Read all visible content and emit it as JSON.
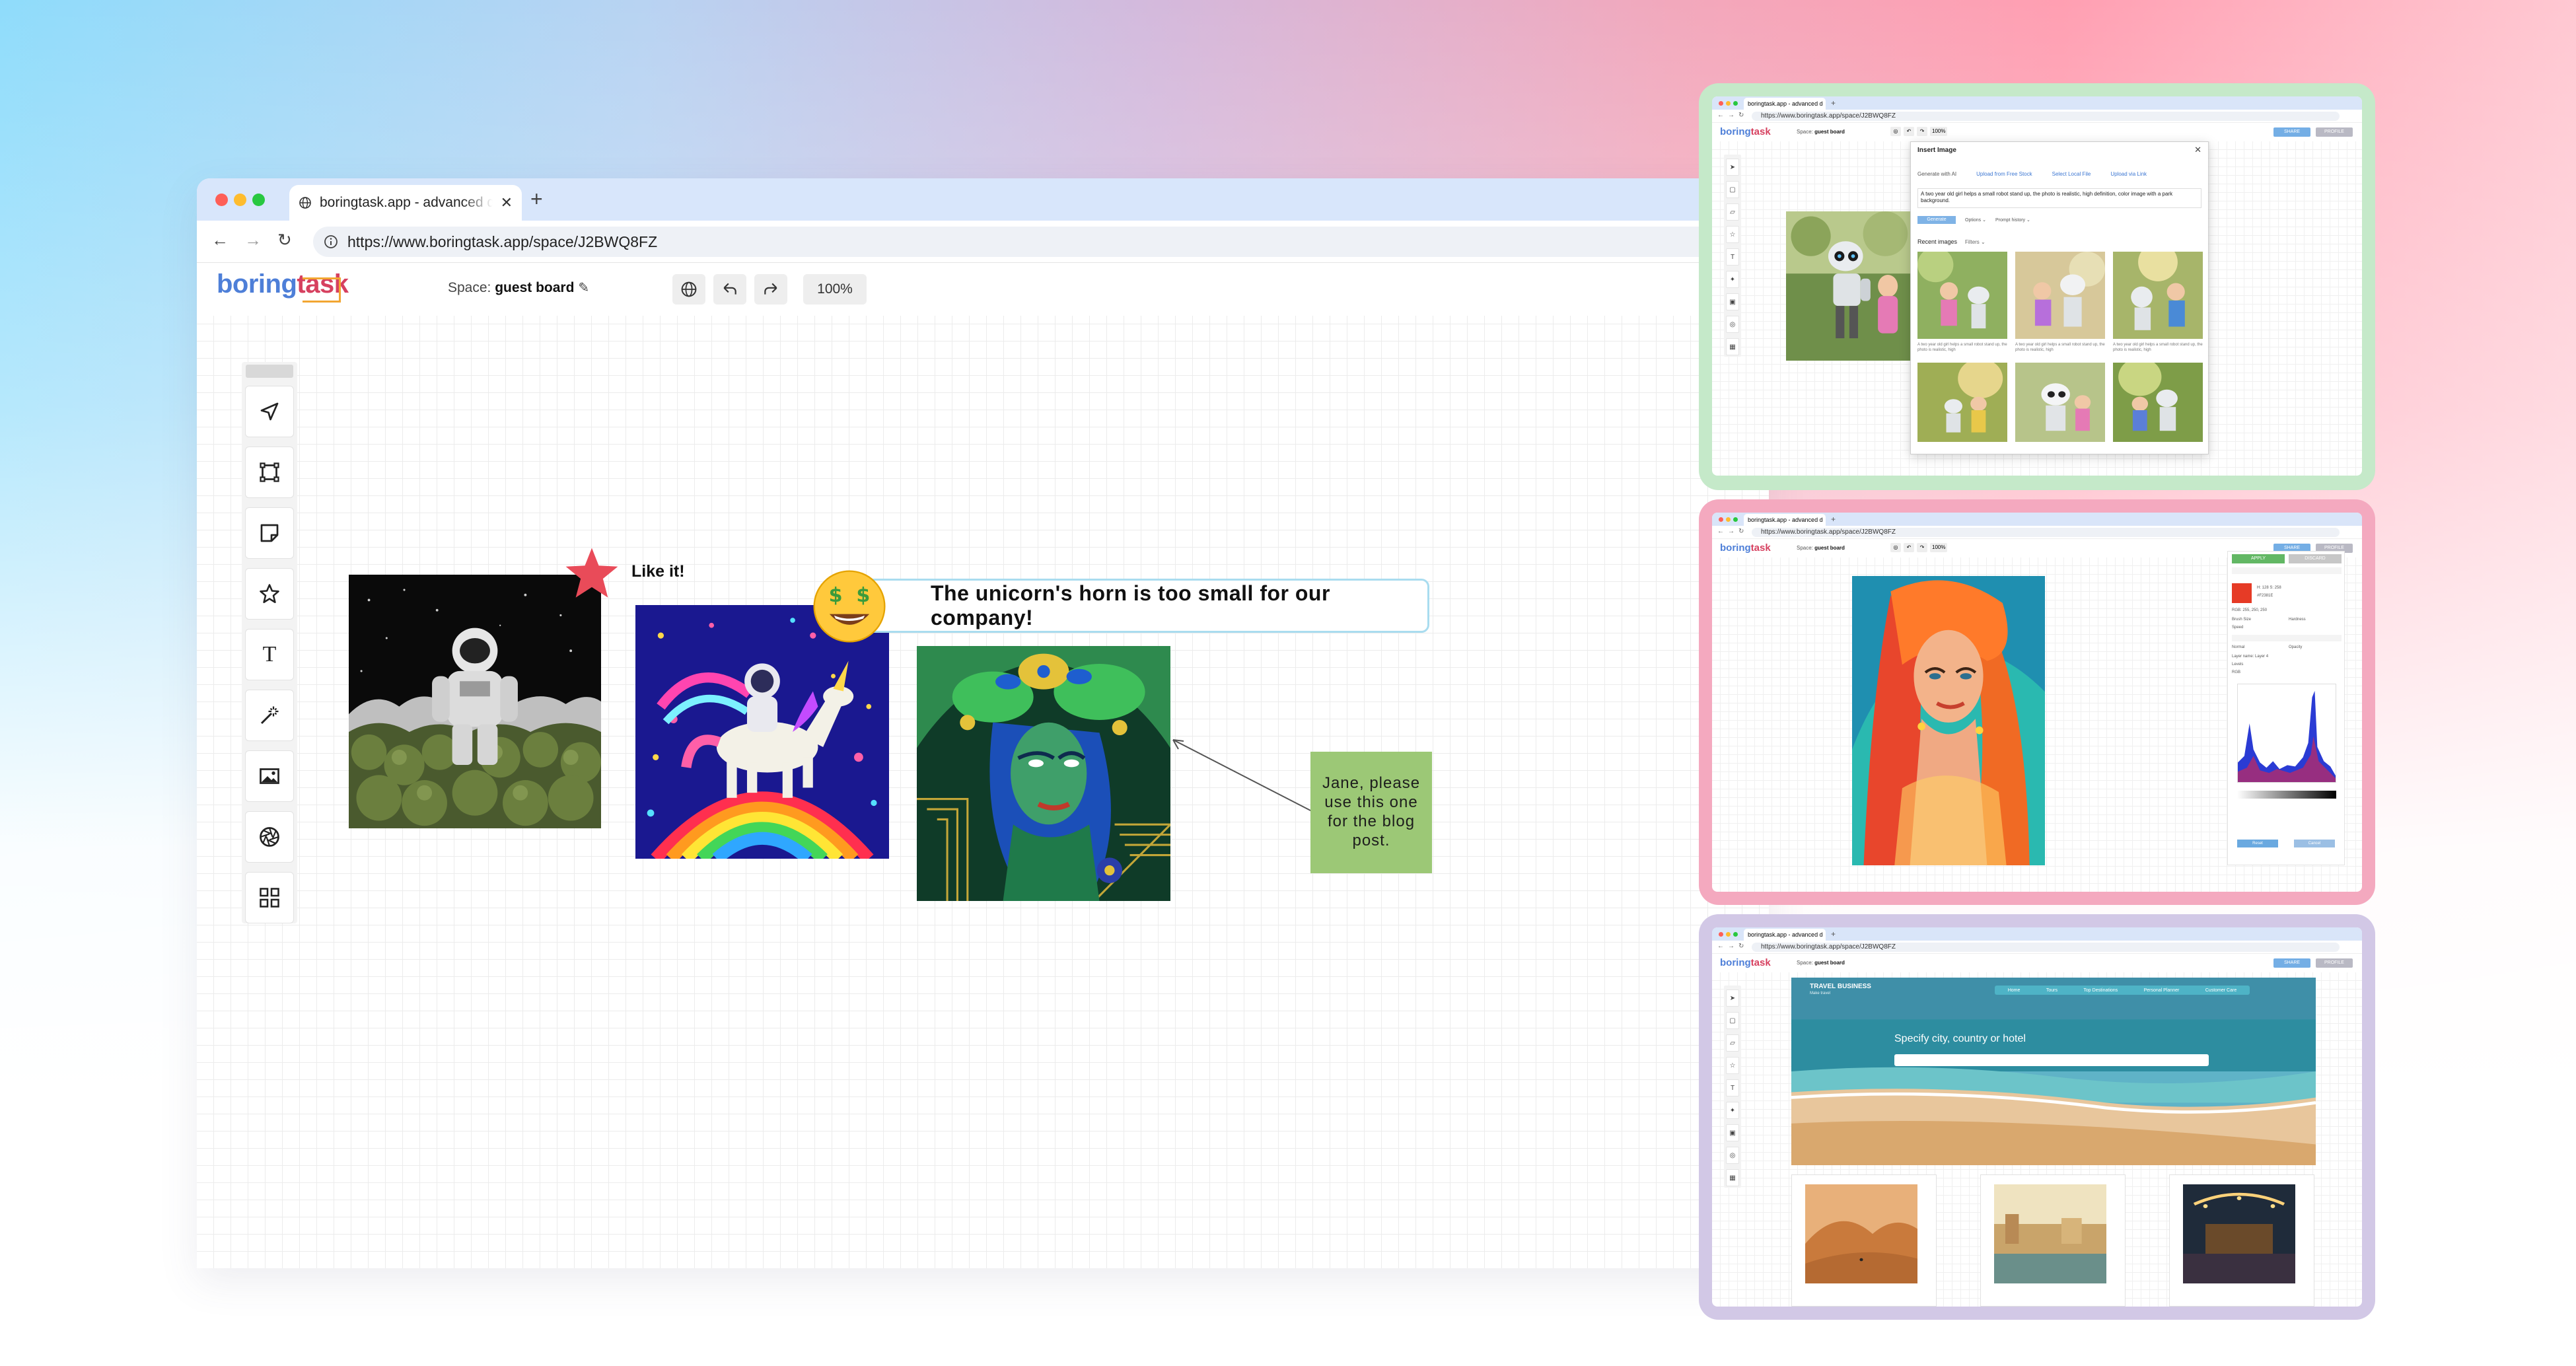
{
  "main_browser": {
    "tab_title": "boringtask.app - advanced d",
    "url": "https://www.boringtask.app/space/J2BWQ8FZ",
    "new_tab_label": "+",
    "tab_close_label": "✕"
  },
  "app_header": {
    "logo_boring": "boring",
    "logo_task": "task",
    "space_label": "Space:",
    "space_name": "guest board",
    "zoom": "100%"
  },
  "toolbar": {
    "tools": [
      "select-tool",
      "frame-tool",
      "sticky-note-tool",
      "shape-tool",
      "text-tool",
      "magic-wand-tool",
      "image-tool",
      "ai-tool",
      "layout-tool"
    ],
    "text_tool_glyph": "T"
  },
  "canvas": {
    "star_annotation_label": "Like it!",
    "comment_text": "The unicorn's horn is too small for our company!",
    "sticky_note_text": "Jane, please use this one for the blog post.",
    "star_color": "#e94b59",
    "sticky_color": "#9cc876",
    "comment_border_color": "#a9dcef"
  },
  "mini_common": {
    "tab_title": "boringtask.app - advanced d",
    "url": "https://www.boringtask.app/space/J2BWQ8FZ",
    "space_label": "Space:",
    "space_name": "guest board",
    "zoom": "100%",
    "share_label": "SHARE",
    "profile_label": "PROFILE",
    "logo_boring": "boring",
    "logo_task": "task"
  },
  "insert_image_dialog": {
    "title": "Insert Image",
    "close": "✕",
    "tabs": [
      "Generate with AI",
      "Upload from Free Stock",
      "Select Local File",
      "Upload via Link"
    ],
    "prompt": "A two year old girl helps a small robot stand up, the photo is realistic, high definition, color image with a park background.",
    "generate_label": "Generate",
    "options_label": "Options ⌄",
    "history_label": "Prompt history ⌄",
    "recent_label": "Recent images",
    "filters_label": "Filters ⌄",
    "caption": "A two year old girl helps a small robot stand up, the photo is realistic, high"
  },
  "editor_panel": {
    "apply_label": "APPLY",
    "discard_label": "DISCARD",
    "hsl": "H: 128  S: 258",
    "rgb_line": "RGB: 255, 250, 250",
    "hex_line": "#F2381E",
    "brush_label": "Brush Size",
    "hardness_label": "Hardness",
    "opacity_label": "Opacity",
    "speed_label": "Speed",
    "normal_label": "Normal",
    "layer_label": "Layer name: Layer 4",
    "levels_label": "Levels",
    "rgb_select": "RGB",
    "reset_label": "Reset",
    "cancel_label": "Cancel",
    "swatch_color": "#e63b26"
  },
  "travel_site": {
    "brand": "TRAVEL BUSINESS",
    "subtitle": "Make travel",
    "nav": [
      "Home",
      "Tours",
      "Top Destinations",
      "Personal Planner",
      "Customer Care"
    ],
    "search_prompt": "Specify city, country or hotel"
  }
}
